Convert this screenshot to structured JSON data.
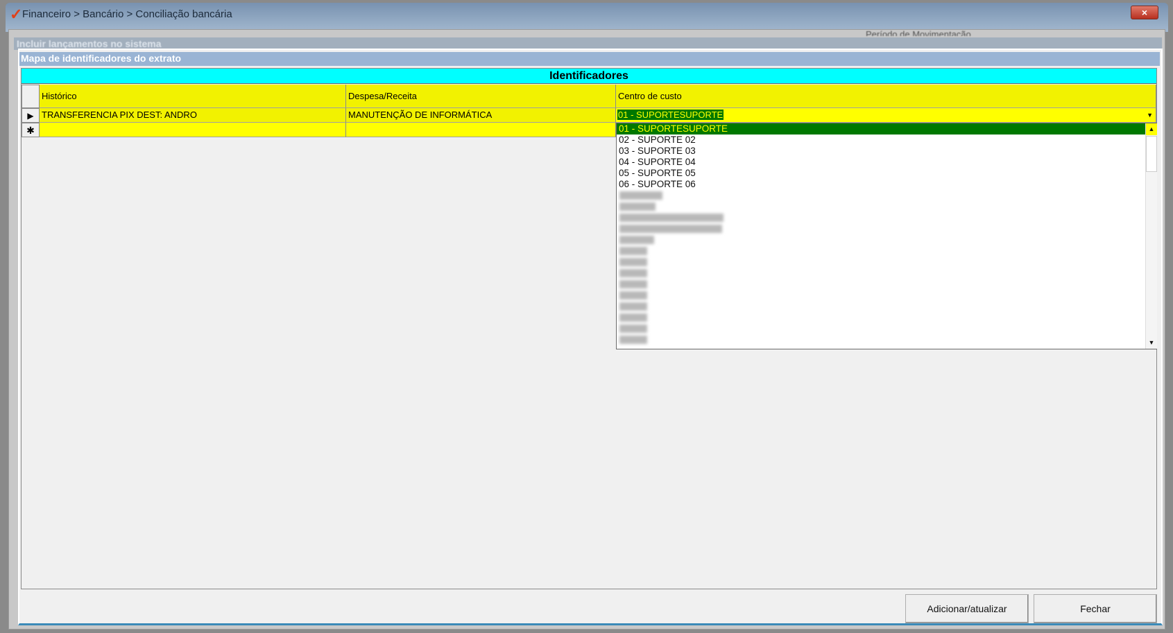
{
  "window": {
    "title": "Financeiro > Bancário > Conciliação bancária",
    "close_icon": "×"
  },
  "background": {
    "parent_title": "Incluir lançamentos no sistema",
    "period_label": "Período de Movimentação"
  },
  "dialog": {
    "title": "Mapa de identificadores do extrato"
  },
  "grid": {
    "title": "Identificadores",
    "columns": [
      "Histórico",
      "Despesa/Receita",
      "Centro de custo"
    ],
    "rows": [
      {
        "indicator": "▶",
        "historico": "TRANSFERENCIA PIX DEST: ANDRO",
        "despesa_receita": "MANUTENÇÃO DE INFORMÁTICA",
        "centro_custo": "01 - SUPORTESUPORTE"
      }
    ],
    "new_row_indicator": "✱"
  },
  "dropdown": {
    "options": [
      "01 - SUPORTESUPORTE",
      "02 - SUPORTE 02",
      "03 - SUPORTE 03",
      "04 - SUPORTE 04",
      "05 - SUPORTE 05",
      "06 - SUPORTE 06"
    ],
    "selected_index": 0
  },
  "buttons": {
    "add_update": "Adicionar/atualizar",
    "close": "Fechar"
  }
}
